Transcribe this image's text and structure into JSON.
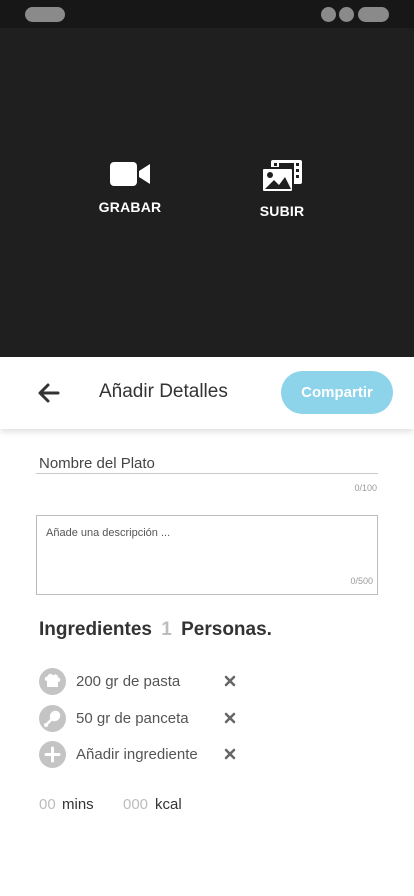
{
  "media": {
    "record_label": "GRABAR",
    "upload_label": "SUBIR",
    "record_icon": "video-camera-icon",
    "upload_icon": "photo-film-icon"
  },
  "header": {
    "title": "Añadir Detalles",
    "share_label": "Compartir",
    "back_icon": "arrow-left-icon",
    "share_color": "#8dd3ea"
  },
  "form": {
    "name_placeholder": "Nombre del Plato",
    "name_counter": "0/100",
    "description_placeholder": "Añade una descripción ...",
    "description_counter": "0/500"
  },
  "ingredients": {
    "title": "Ingredientes",
    "people_count": "1",
    "people_label": "Personas.",
    "items": [
      {
        "label": "200 gr de pasta",
        "icon": "chef-hat-icon"
      },
      {
        "label": "50 gr de panceta",
        "icon": "drumstick-icon"
      },
      {
        "label": "Añadir ingrediente",
        "icon": "plus-circle-icon"
      }
    ],
    "remove_icon": "close-icon"
  },
  "stats": {
    "time_value": "00",
    "time_unit": "mins",
    "kcal_value": "000",
    "kcal_unit": "kcal"
  }
}
